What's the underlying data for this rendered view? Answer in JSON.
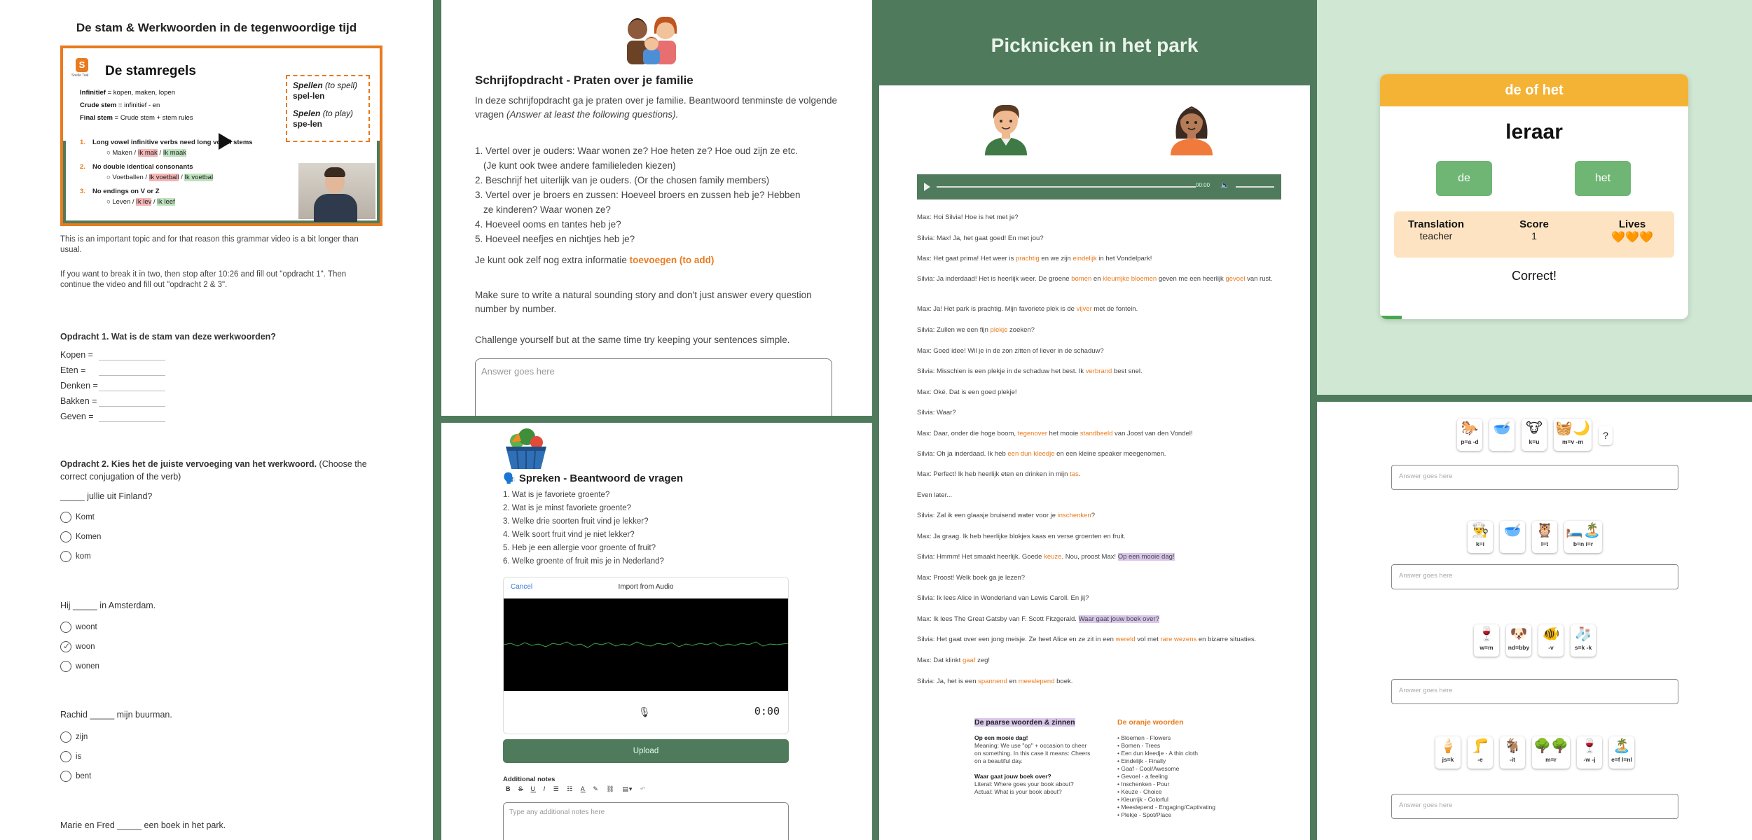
{
  "p1": {
    "title": "De stam & Werkwoorden in de tegenwoordige tijd",
    "video": {
      "logo_letter": "S",
      "logo_text": "Snelle Taal",
      "heading": "De stamregels",
      "lines": {
        "l1_label": "Infinitief",
        "l1_text": " = kopen, maken, lopen",
        "l2_label": "Crude stem",
        "l2_text": " = infinitief - en",
        "l3_label": "Final stem",
        "l3_text": " = Crude stem + stem rules"
      },
      "spell1_label": "Spellen",
      "spell1_note": " (to spell)",
      "spell1_word": "spel-len",
      "spell2_label": "Spelen",
      "spell2_note": " (to play)",
      "spell2_word": "spe-len",
      "rules": [
        {
          "num": "1.",
          "title": "Long vowel infinitive verbs need long vowel stems",
          "ex": "Maken / Ik mak / Ik maak"
        },
        {
          "num": "2.",
          "title": "No double identical consonants",
          "ex": "Voetballen / Ik voetball / Ik voetbal"
        },
        {
          "num": "3.",
          "title": "No endings on V or Z",
          "ex": "Leven / Ik lev / Ik leef"
        }
      ]
    },
    "para1": "This is an important topic and for that reason this grammar video is a bit longer than usual.",
    "para2": "If you want to break it in two, then stop after 10:26 and fill out \"opdracht 1\". Then continue the video and fill out \"opdracht 2 & 3\".",
    "q1_title": "Opdracht 1. Wat is de stam van deze werkwoorden?",
    "q1_items": [
      "Kopen =",
      "Eten =",
      "Denken =",
      "Bakken =",
      "Geven ="
    ],
    "q2_title": "Opdracht 2. Kies het de juiste vervoeging van het werkwoord.",
    "q2_note": " (Choose the correct conjugation of the verb)",
    "s1": "_____ jullie uit Finland?",
    "s1_opts": [
      "Komt",
      "Komen",
      "kom"
    ],
    "s2": "Hij _____ in Amsterdam.",
    "s2_opts": [
      "woont",
      "woon",
      "wonen"
    ],
    "s3": "Rachid _____ mijn buurman.",
    "s3_opts": [
      "zijn",
      "is",
      "bent"
    ],
    "s4": "Marie en Fred _____ een boek in het park."
  },
  "p2": {
    "title": "Schrijfopdracht - Praten over je familie",
    "intro": "In deze schrijfopdracht ga je praten over je familie. Beantwoord tenminste de volgende vragen ",
    "intro_en": "(Answer at least the following questions).",
    "items": [
      "1. Vertel over je ouders: Waar wonen ze? Hoe heten ze? Hoe oud zijn ze etc.",
      "(Je kunt ook twee andere familieleden kiezen)",
      "2. Beschrijf het uiterlijk van je ouders. (Or the chosen family members)",
      "3. Vertel over je broers en zussen: Hoeveel broers en zussen heb je? Hebben",
      "ze kinderen? Waar wonen ze?",
      "4. Hoeveel ooms en tantes heb je?",
      "5. Hoeveel neefjes en nichtjes heb je?"
    ],
    "extra": "Je kunt ook zelf nog extra informatie ",
    "extra_orange": "toevoegen (to add)",
    "tip1": "Make sure to write a natural sounding story and don't just answer every question number by number.",
    "tip2": "Challenge yourself but at the same time try keeping your sentences simple.",
    "answer_placeholder": "Answer goes here"
  },
  "p3": {
    "title": "🗣️ Spreken - Beantwoord de vragen",
    "items": [
      "1. Wat is je favoriete groente?",
      "2. Wat is je minst favoriete groente?",
      "3. Welke drie soorten fruit vind je lekker?",
      "4. Welk soort fruit vind je niet lekker?",
      "5. Heb je een allergie voor groente of fruit?",
      "6. Welke groente of fruit mis je in Nederland?"
    ],
    "cancel": "Cancel",
    "import": "Import from Audio",
    "timer": "0:00",
    "upload": "Upload",
    "notes_label": "Additional notes",
    "notes_placeholder": "Type any additional notes here",
    "toolbar": [
      "B",
      "S",
      "U",
      "I",
      "☰",
      "☷",
      "A",
      "✎",
      "⛓",
      "▤▾",
      "↶"
    ]
  },
  "p4": {
    "title": "Picknicken in het park",
    "audio_time": "00:00",
    "dialogue": [
      [
        {
          "t": "Max: Hoi Silvia! Hoe is het met je?"
        }
      ],
      [
        {
          "t": "Silvia: Max! Ja, het gaat goed! En met jou?"
        }
      ],
      [
        {
          "t": "Max: Het gaat prima! Het weer is "
        },
        {
          "t": "prachtig",
          "c": "o"
        },
        {
          "t": " en we zijn "
        },
        {
          "t": "eindelijk",
          "c": "o"
        },
        {
          "t": " in het Vondelpark!"
        }
      ],
      [
        {
          "t": "Silvia: Ja inderdaad! Het is heerlijk weer. De groene "
        },
        {
          "t": "bomen",
          "c": "o"
        },
        {
          "t": " en "
        },
        {
          "t": "kleurrijke bloemen",
          "c": "o"
        },
        {
          "t": " geven me een heerlijk "
        },
        {
          "t": "gevoel",
          "c": "o"
        },
        {
          "t": " van rust."
        }
      ],
      [
        {
          "t": "Max: Ja! Het park is prachtig. Mijn favoriete plek is de "
        },
        {
          "t": "vijver",
          "c": "o"
        },
        {
          "t": " met de fontein."
        }
      ],
      [
        {
          "t": "Silvia: Zullen we een fijn "
        },
        {
          "t": "plekje",
          "c": "o"
        },
        {
          "t": " zoeken?"
        }
      ],
      [
        {
          "t": "Max: Goed idee! Wil je in de zon zitten of liever in de schaduw?"
        }
      ],
      [
        {
          "t": "Silvia: Misschien is een plekje in de schaduw het best. Ik "
        },
        {
          "t": "verbrand",
          "c": "o"
        },
        {
          "t": " best snel."
        }
      ],
      [
        {
          "t": "Max: Oké. Dat is een goed plekje!"
        }
      ],
      [
        {
          "t": "Silvia: Waar?"
        }
      ],
      [
        {
          "t": "Max: Daar, onder die hoge boom, "
        },
        {
          "t": "tegenover",
          "c": "o"
        },
        {
          "t": " het mooie "
        },
        {
          "t": "standbeeld",
          "c": "o"
        },
        {
          "t": " van Joost van den Vondel!"
        }
      ],
      [
        {
          "t": "Silvia: Oh ja inderdaad. Ik heb "
        },
        {
          "t": "een dun kleedje",
          "c": "o"
        },
        {
          "t": " en een kleine speaker meegenomen."
        }
      ],
      [
        {
          "t": "Max: Perfect! Ik heb heerlijk eten en drinken in mijn "
        },
        {
          "t": "tas",
          "c": "o"
        },
        {
          "t": "."
        }
      ],
      [
        {
          "t": "Even later..."
        }
      ],
      [
        {
          "t": "Silvia: Zal ik een glaasje bruisend water voor je "
        },
        {
          "t": "inschenken",
          "c": "o"
        },
        {
          "t": "?"
        }
      ],
      [
        {
          "t": "Max: Ja graag. Ik heb heerlijke blokjes kaas en verse groenten en fruit."
        }
      ],
      [
        {
          "t": "Silvia: Hmmm! Het smaakt heerlijk. Goede "
        },
        {
          "t": "keuze",
          "c": "o"
        },
        {
          "t": ". Nou, proost Max! "
        },
        {
          "t": "Op een mooie dag!",
          "c": "p"
        }
      ],
      [
        {
          "t": "Max: Proost! Welk boek ga je lezen?"
        }
      ],
      [
        {
          "t": "Silvia: Ik lees Alice in Wonderland van Lewis Caroll. En jij?"
        }
      ],
      [
        {
          "t": "Max: Ik lees The Great Gatsby van F. Scott Fitzgerald. "
        },
        {
          "t": "Waar gaat jouw boek over?",
          "c": "p"
        }
      ],
      [
        {
          "t": "Silvia: Het gaat over een jong meisje. Ze heet Alice en ze zit in een "
        },
        {
          "t": "wereld",
          "c": "o"
        },
        {
          "t": " vol met "
        },
        {
          "t": "rare wezens",
          "c": "o"
        },
        {
          "t": " en bizarre situaties."
        }
      ],
      [
        {
          "t": "Max: Dat klinkt "
        },
        {
          "t": "gaaf",
          "c": "o"
        },
        {
          "t": " zeg!"
        }
      ],
      [
        {
          "t": "Silvia: Ja, het is een "
        },
        {
          "t": "spannend",
          "c": "o"
        },
        {
          "t": " en "
        },
        {
          "t": "meeslepend",
          "c": "o"
        },
        {
          "t": " boek."
        }
      ]
    ],
    "purple_head": "De paarse woorden & zinnen",
    "purple_items": [
      {
        "h": "Op een mooie dag!",
        "l": [
          "Meaning: We use \"op\" + occasion to cheer",
          "on something. In this case it means: Cheers",
          "on a beautiful day."
        ]
      },
      {
        "h": "Waar gaat jouw boek over?",
        "l": [
          "Literal: Where goes your book about?",
          "Actual: What is your book about?"
        ]
      }
    ],
    "orange_head": "De oranje woorden",
    "orange_items": [
      "Bloemen - Flowers",
      "Bomen - Trees",
      "Een dun kleedje - A thin cloth",
      "Eindelijk - Finally",
      "Gaaf - Cool/Awesome",
      "Gevoel - a feeling",
      "Inschenken - Pour",
      "Keuze - Choice",
      "Kleurrijk - Colorful",
      "Meeslepend - Engaging/Captivating",
      "Plekje - Spot/Place"
    ]
  },
  "p5": {
    "header": "de of het",
    "word": "leraar",
    "btn_de": "de",
    "btn_het": "het",
    "translation_label": "Translation",
    "translation": "teacher",
    "score_label": "Score",
    "score": "1",
    "lives_label": "Lives",
    "lives": "🧡🧡🧡",
    "feedback": "Correct!",
    "progress_fraction": 0.07
  },
  "p6": {
    "placeholder": "Answer goes here",
    "rows": [
      [
        {
          "e": "🐎",
          "c": "p=a -d"
        },
        {
          "e": "🥣",
          "c": ""
        },
        {
          "e": "🐮",
          "c": "k=u"
        },
        {
          "e": "🧺🌙",
          "c": "m=v  -m",
          "w": true
        },
        {
          "e": "?",
          "c": "",
          "q": true
        }
      ],
      [
        {
          "e": "👨‍🍳",
          "c": "k=i"
        },
        {
          "e": "🥣",
          "c": ""
        },
        {
          "e": "🦉",
          "c": "l=t"
        },
        {
          "e": "🛏️🏝️",
          "c": "b=n   i=r",
          "w": true
        }
      ],
      [
        {
          "e": "🍷",
          "c": "w=m"
        },
        {
          "e": "🐶",
          "c": "nd=bby"
        },
        {
          "e": "🐠",
          "c": "-v"
        },
        {
          "e": "🧦",
          "c": "s=k -k"
        }
      ],
      [
        {
          "e": "🍦",
          "c": "js=k"
        },
        {
          "e": "🦵",
          "c": "-e"
        },
        {
          "e": "🐐",
          "c": "-it"
        },
        {
          "e": "🌳🌳",
          "c": "m=r",
          "w": true
        },
        {
          "e": "🍷",
          "c": "-w -j"
        },
        {
          "e": "🏝️",
          "c": "e=f l=nl"
        }
      ]
    ]
  },
  "colors": {
    "green": "#4f7b5c",
    "orange": "#e97b1e",
    "yellow": "#f5b335",
    "purple_highlight": "#d9c6ea"
  }
}
